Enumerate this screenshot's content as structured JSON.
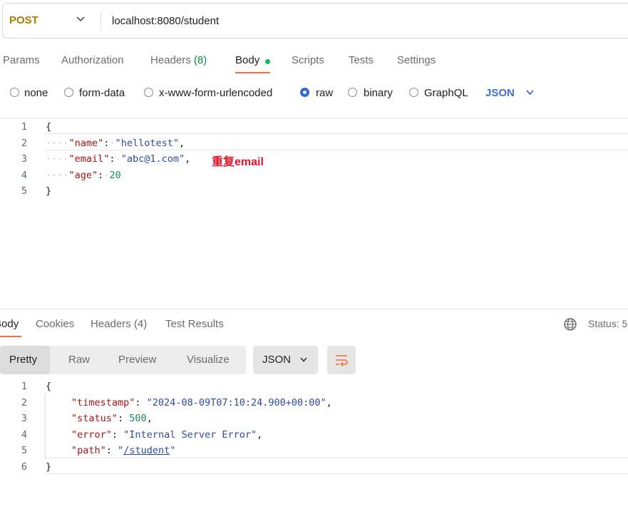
{
  "request": {
    "method": "POST",
    "url": "localhost:8080/student"
  },
  "request_tabs": [
    {
      "label": "Params"
    },
    {
      "label": "Authorization"
    },
    {
      "label": "Headers",
      "count": "(8)"
    },
    {
      "label": "Body"
    },
    {
      "label": "Scripts"
    },
    {
      "label": "Tests"
    },
    {
      "label": "Settings"
    }
  ],
  "body_types": [
    "none",
    "form-data",
    "x-www-form-urlencoded",
    "raw",
    "binary",
    "GraphQL"
  ],
  "selected_body_type": "raw",
  "body_format": "JSON",
  "request_body": {
    "line_numbers": [
      "1",
      "2",
      "3",
      "4",
      "5"
    ],
    "open_brace": "{",
    "close_brace": "}",
    "name_key": "\"name\"",
    "name_value": "\"hellotest\"",
    "email_key": "\"email\"",
    "email_value": "\"abc@1.com\"",
    "age_key": "\"age\"",
    "age_value": "20",
    "annotation": "重复email"
  },
  "response_tabs": [
    {
      "label": "Body"
    },
    {
      "label": "Cookies"
    },
    {
      "label": "Headers",
      "count": "(4)"
    },
    {
      "label": "Test Results"
    }
  ],
  "status_label": "Status: 5",
  "view_modes": [
    "Pretty",
    "Raw",
    "Preview",
    "Visualize"
  ],
  "response_format": "JSON",
  "response_body": {
    "line_numbers": [
      "1",
      "2",
      "3",
      "4",
      "5",
      "6"
    ],
    "open_brace": "{",
    "close_brace": "}",
    "timestamp_key": "\"timestamp\"",
    "timestamp_value": "\"2024-08-09T07:10:24.900+00:00\"",
    "status_key": "\"status\"",
    "status_value": "500",
    "error_key": "\"error\"",
    "error_value": "\"Internal Server Error\"",
    "path_key": "\"path\"",
    "path_value": "/student"
  },
  "colors": {
    "accent": "#ff6c37",
    "method": "#ad7a03",
    "radio_selected": "#2f69d8",
    "annotation": "#e0152a"
  },
  "icons": [
    "chevron-down-icon",
    "globe-icon",
    "wrap-lines-icon"
  ]
}
